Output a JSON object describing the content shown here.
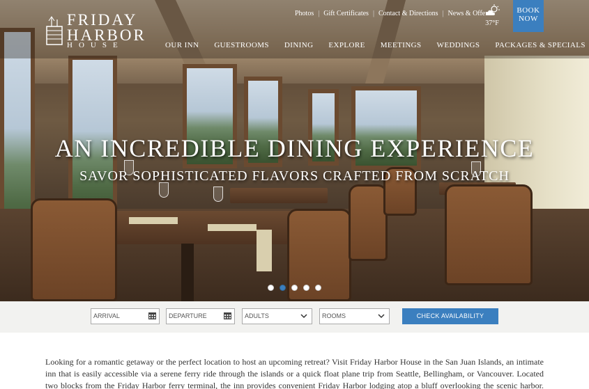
{
  "brand": {
    "line1": "FRIDAY",
    "line2": "HARBOR",
    "line3": "HOUSE"
  },
  "util_links": [
    "Photos",
    "Gift Certificates",
    "Contact & Directions",
    "News & Offers"
  ],
  "util_separator": "|",
  "weather": {
    "icon": "partly-cloudy-icon",
    "temp": "37°F"
  },
  "book_now": {
    "line1": "BOOK",
    "line2": "NOW"
  },
  "nav": [
    "OUR INN",
    "GUESTROOMS",
    "DINING",
    "EXPLORE",
    "MEETINGS",
    "WEDDINGS",
    "PACKAGES & SPECIALS"
  ],
  "hero": {
    "title": "AN INCREDIBLE DINING EXPERIENCE",
    "subtitle": "SAVOR SOPHISTICATED FLAVORS CRAFTED FROM SCRATCH",
    "slide_count": 5,
    "active_slide": 2
  },
  "booking": {
    "arrival_placeholder": "ARRIVAL",
    "departure_placeholder": "DEPARTURE",
    "adults_label": "ADULTS",
    "rooms_label": "ROOMS",
    "check_label": "CHECK AVAILABILITY"
  },
  "intro_text": "Looking for a romantic getaway or the perfect location to host an upcoming retreat? Visit Friday Harbor House in the San Juan Islands, an intimate inn that is easily accessible via a serene ferry ride through the islands or a quick float plane trip from Seattle, Bellingham, or Vancouver. Located two blocks from the Friday Harbor ferry terminal, the inn provides convenient Friday Harbor lodging atop a bluff overlooking the scenic harbor. Book your ferry",
  "colors": {
    "accent": "#3b7fbf"
  }
}
